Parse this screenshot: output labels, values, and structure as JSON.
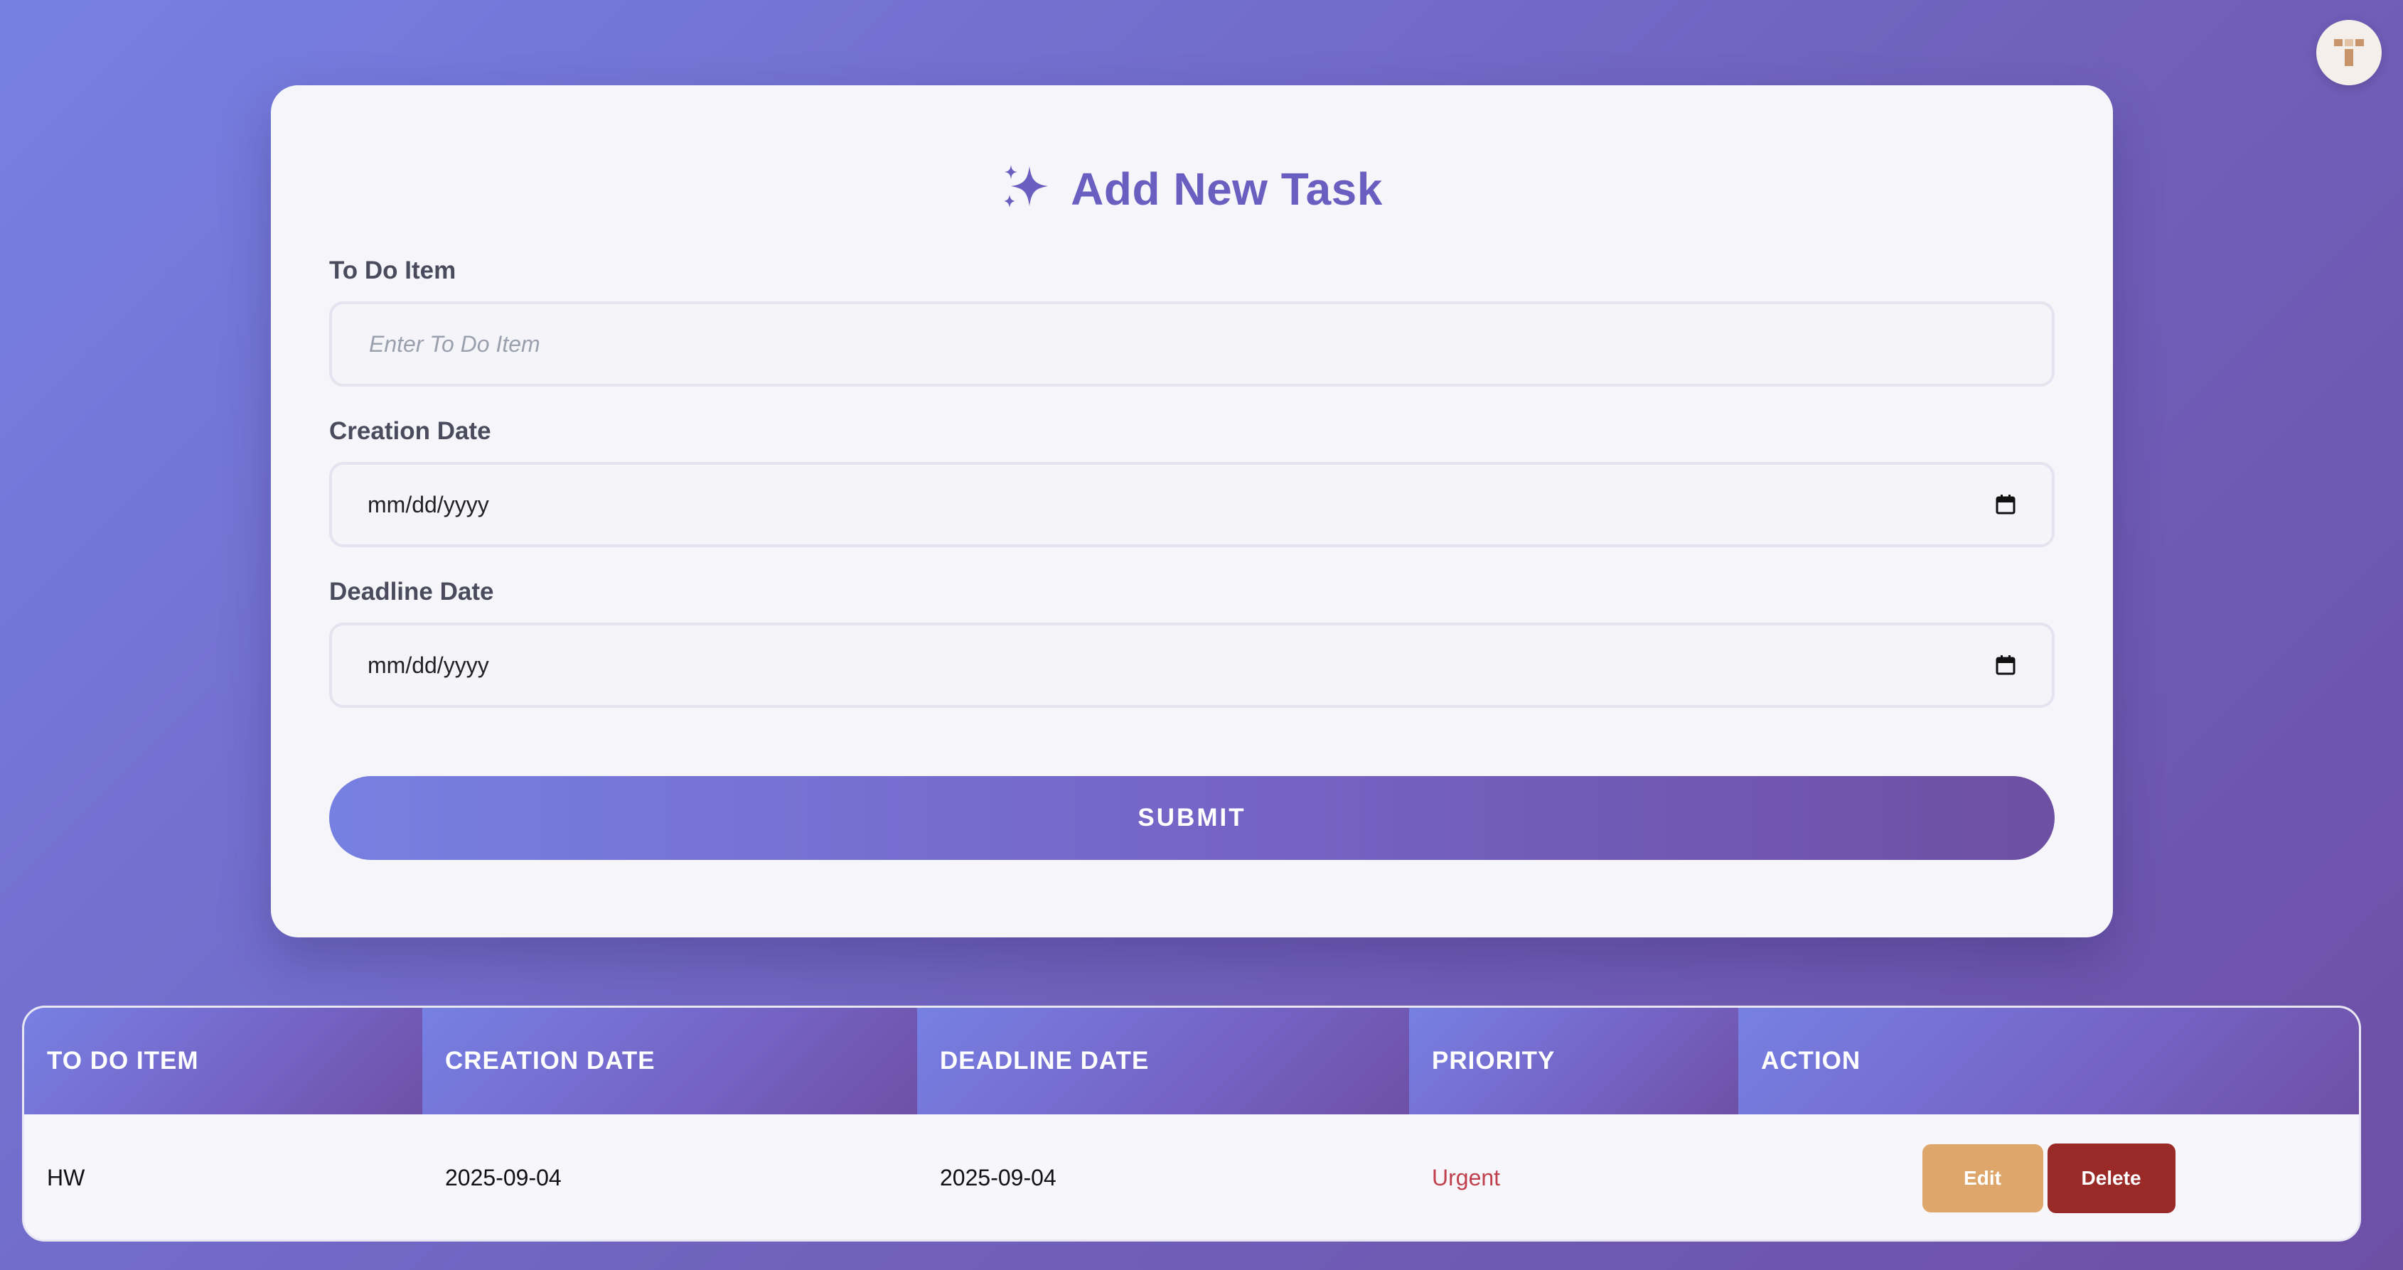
{
  "colors": {
    "accent": "#6a5fc0",
    "gradient_start": "#7680e3",
    "gradient_end": "#6d4fa6",
    "edit_button": "#dea66a",
    "delete_button": "#992a28",
    "priority_urgent": "#c0404e"
  },
  "header": {
    "avatar_icon": "user-avatar-icon"
  },
  "form": {
    "title_icon": "sparkles-icon",
    "title": "Add New Task",
    "todo_label": "To Do Item",
    "todo_placeholder": "Enter To Do Item",
    "todo_value": "",
    "creation_label": "Creation Date",
    "creation_value": "mm/dd/yyyy",
    "deadline_label": "Deadline Date",
    "deadline_value": "mm/dd/yyyy",
    "calendar_icon": "calendar-icon",
    "submit_label": "SUBMIT"
  },
  "table": {
    "columns": [
      "TO DO ITEM",
      "CREATION DATE",
      "DEADLINE DATE",
      "PRIORITY",
      "ACTION"
    ],
    "rows": [
      {
        "item": "HW",
        "creation_date": "2025-09-04",
        "deadline_date": "2025-09-04",
        "priority": "Urgent",
        "edit_label": "Edit",
        "delete_label": "Delete"
      }
    ]
  }
}
